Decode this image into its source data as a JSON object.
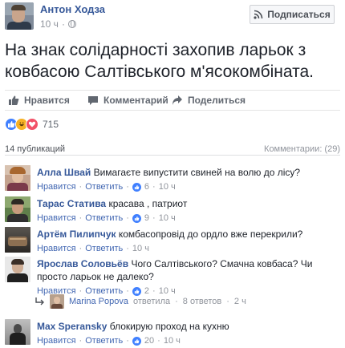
{
  "post": {
    "author": "Антон Ходза",
    "time": "10 ч",
    "subscribe_label": "Подписаться",
    "text": "На знак солідарності захопив ларьок з ковбасою Салтівського м'ясокомбіната."
  },
  "actions": {
    "like": "Нравится",
    "comment": "Комментарий",
    "share": "Поделиться"
  },
  "reactions": {
    "count": "715"
  },
  "stats": {
    "publications": "14 публикаций",
    "comments": "Комментарии: (29)"
  },
  "comments": [
    {
      "author": "Алла Швай",
      "text": "Вимагаєте випустити свиней на волю до лісу?",
      "like": "Нравится",
      "reply": "Ответить",
      "likes": "6",
      "time": "10 ч"
    },
    {
      "author": "Тарас Статива",
      "text": "красава , патриот",
      "like": "Нравится",
      "reply": "Ответить",
      "likes": "9",
      "time": "10 ч"
    },
    {
      "author": "Артём Пилипчук",
      "text": "комбасопровід до ордло вже перекрили?",
      "like": "Нравится",
      "reply": "Ответить",
      "likes": "",
      "time": "10 ч"
    },
    {
      "author": "Ярослав Соловьёв",
      "text": "Чого Салтівського? Смачна ковбаса? Чи просто ларьок не далеко?",
      "like": "Нравится",
      "reply": "Ответить",
      "likes": "2",
      "time": "10 ч"
    },
    {
      "author": "Max Speransky",
      "text": "блокирую проход на кухню",
      "like": "Нравится",
      "reply": "Ответить",
      "likes": "20",
      "time": "10 ч"
    }
  ],
  "reply_summary": {
    "author": "Marina Popova",
    "action": "ответила",
    "count": "8 ответов",
    "time": "2 ч"
  },
  "colors": {
    "link": "#365899",
    "muted": "#90949c",
    "like_blue": "#4080ff"
  }
}
